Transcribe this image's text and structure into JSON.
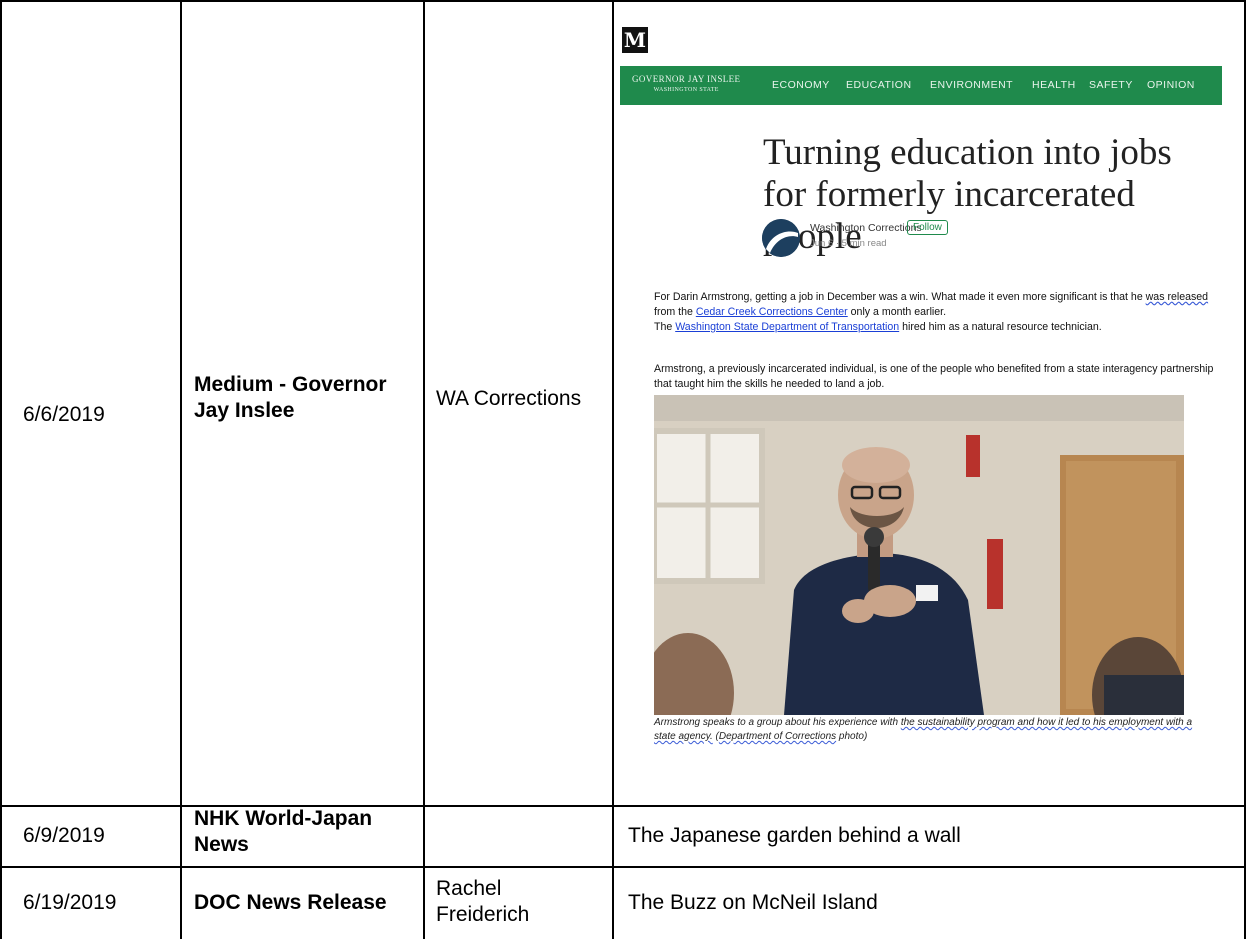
{
  "rows": [
    {
      "date": "6/6/2019",
      "outlet": "Medium - Governor Jay Inslee",
      "author": "WA Corrections",
      "title": ""
    },
    {
      "date": "6/9/2019",
      "outlet": "NHK World-Japan News",
      "author": "",
      "title": "The Japanese garden behind a wall"
    },
    {
      "date": "6/19/2019",
      "outlet": "DOC News Release",
      "author": "Rachel Freiderich",
      "title": "The Buzz on McNeil Island"
    }
  ],
  "article": {
    "logo": "M",
    "brand_line1": "GOVERNOR JAY INSLEE",
    "brand_line2": "WASHINGTON STATE",
    "nav": [
      "ECONOMY",
      "EDUCATION",
      "ENVIRONMENT",
      "HEALTH",
      "SAFETY",
      "OPINION"
    ],
    "headline": "Turning education into jobs for formerly incarcerated people",
    "author": "Washington Corrections",
    "follow": "Follow",
    "meta": "Jun 6 · 5 min read",
    "p1_a": "For Darin Armstrong, getting a job in December was a win. What made it even more significant is that he ",
    "p1_b": "was released",
    "p1_c": " from the ",
    "p1_link1": "Cedar Creek Corrections Center",
    "p1_d": " only a month earlier.",
    "p1_e": "The ",
    "p1_link2": "Washington State Department of Transportation",
    "p1_f": " hired him as a natural resource technician.",
    "p2": "Armstrong, a previously incarcerated individual, is one of the people who benefited from a state interagency partnership that taught him the skills he needed to land a job.",
    "caption_a": "Armstrong speaks to a group about his experience with ",
    "caption_b": "the sustainability program and how it led to his employment with a state agency.",
    "caption_c": " (",
    "caption_d": "Department of Corrections",
    "caption_e": " photo)"
  }
}
